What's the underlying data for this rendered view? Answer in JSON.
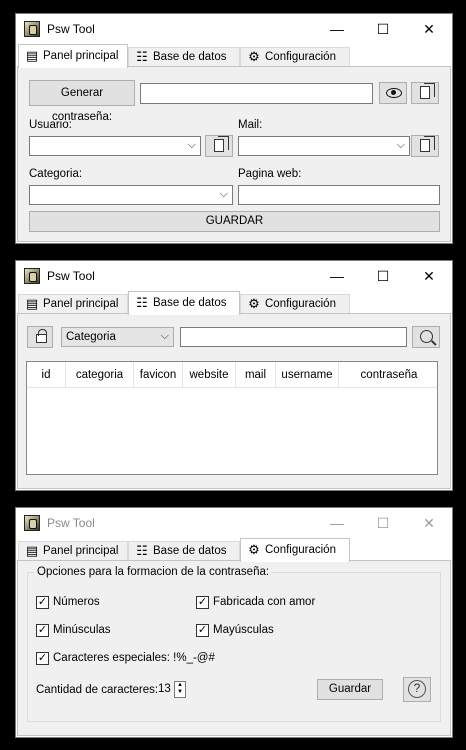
{
  "app_title": "Psw Tool",
  "window_buttons": {
    "minimize": "—",
    "maximize": "☐",
    "close": "✕"
  },
  "tabs": [
    {
      "label": "Panel principal",
      "icon": "id-card-icon"
    },
    {
      "label": "Base de datos",
      "icon": "database-icon"
    },
    {
      "label": "Configuración",
      "icon": "gear-icon"
    }
  ],
  "panel_principal": {
    "generate_button": "Generar contraseña:",
    "password_value": "",
    "usuario_label": "Usuario:",
    "usuario_value": "",
    "mail_label": "Mail:",
    "mail_value": "",
    "categoria_label": "Categoria:",
    "categoria_value": "",
    "pagina_web_label": "Pagina web:",
    "pagina_web_value": "",
    "save_button": "GUARDAR"
  },
  "base_de_datos": {
    "filter_value": "Categoria",
    "search_value": "",
    "columns": [
      "id",
      "categoria",
      "favicon",
      "website",
      "mail",
      "username",
      "contraseña"
    ],
    "rows": []
  },
  "configuracion": {
    "group_title": "Opciones para la formacion de la contraseña:",
    "options": [
      {
        "label": "Números",
        "checked": true
      },
      {
        "label": "Fabricada con amor",
        "checked": true
      },
      {
        "label": "Minúsculas",
        "checked": true
      },
      {
        "label": "Mayúsculas",
        "checked": true
      },
      {
        "label": "Caracteres especiales: !%_-@#",
        "checked": true
      }
    ],
    "length_label": "Cantidad de caracteres:",
    "length_value": "13",
    "save_button": "Guardar",
    "help_symbol": "?"
  }
}
